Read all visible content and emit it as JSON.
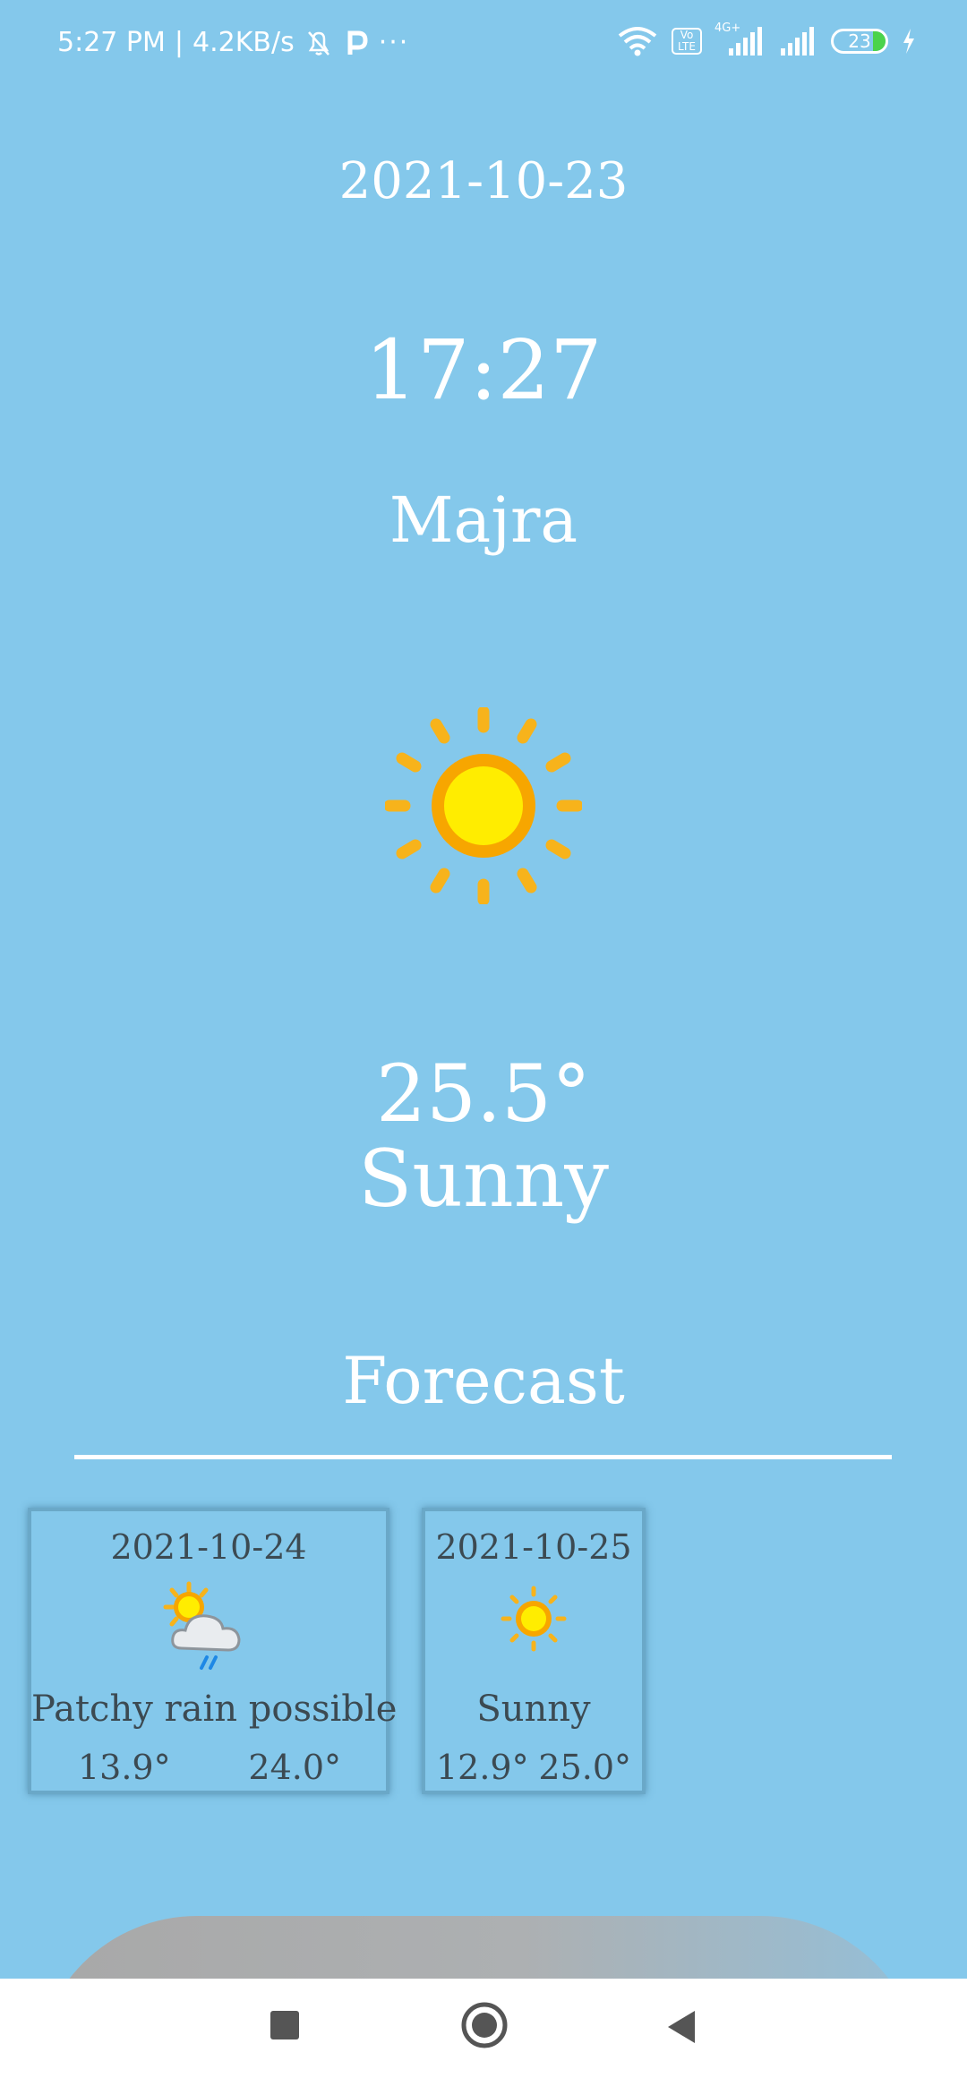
{
  "status_bar": {
    "time": "5:27 PM",
    "speed": "4.2KB/s",
    "network": "4G+",
    "volte": "Vo LTE",
    "battery": "23"
  },
  "weather": {
    "date": "2021-10-23",
    "time": "17:27",
    "location": "Majra",
    "temperature": "25.5°",
    "condition": "Sunny",
    "icon": "sun-icon"
  },
  "forecast": {
    "title": "Forecast",
    "days": [
      {
        "date": "2021-10-24",
        "condition": "Patchy rain possible",
        "min": "13.9°",
        "max": "24.0°",
        "icon": "patchy-rain-icon"
      },
      {
        "date": "2021-10-25",
        "condition": "Sunny",
        "min": "12.9°",
        "max": "25.0°",
        "icon": "sun-icon"
      }
    ]
  },
  "colors": {
    "background": "#84c8eb",
    "text": "#ffffff",
    "card_text": "#3c4a52",
    "sun": "#ffed00",
    "sun_ring": "#f7a600"
  }
}
